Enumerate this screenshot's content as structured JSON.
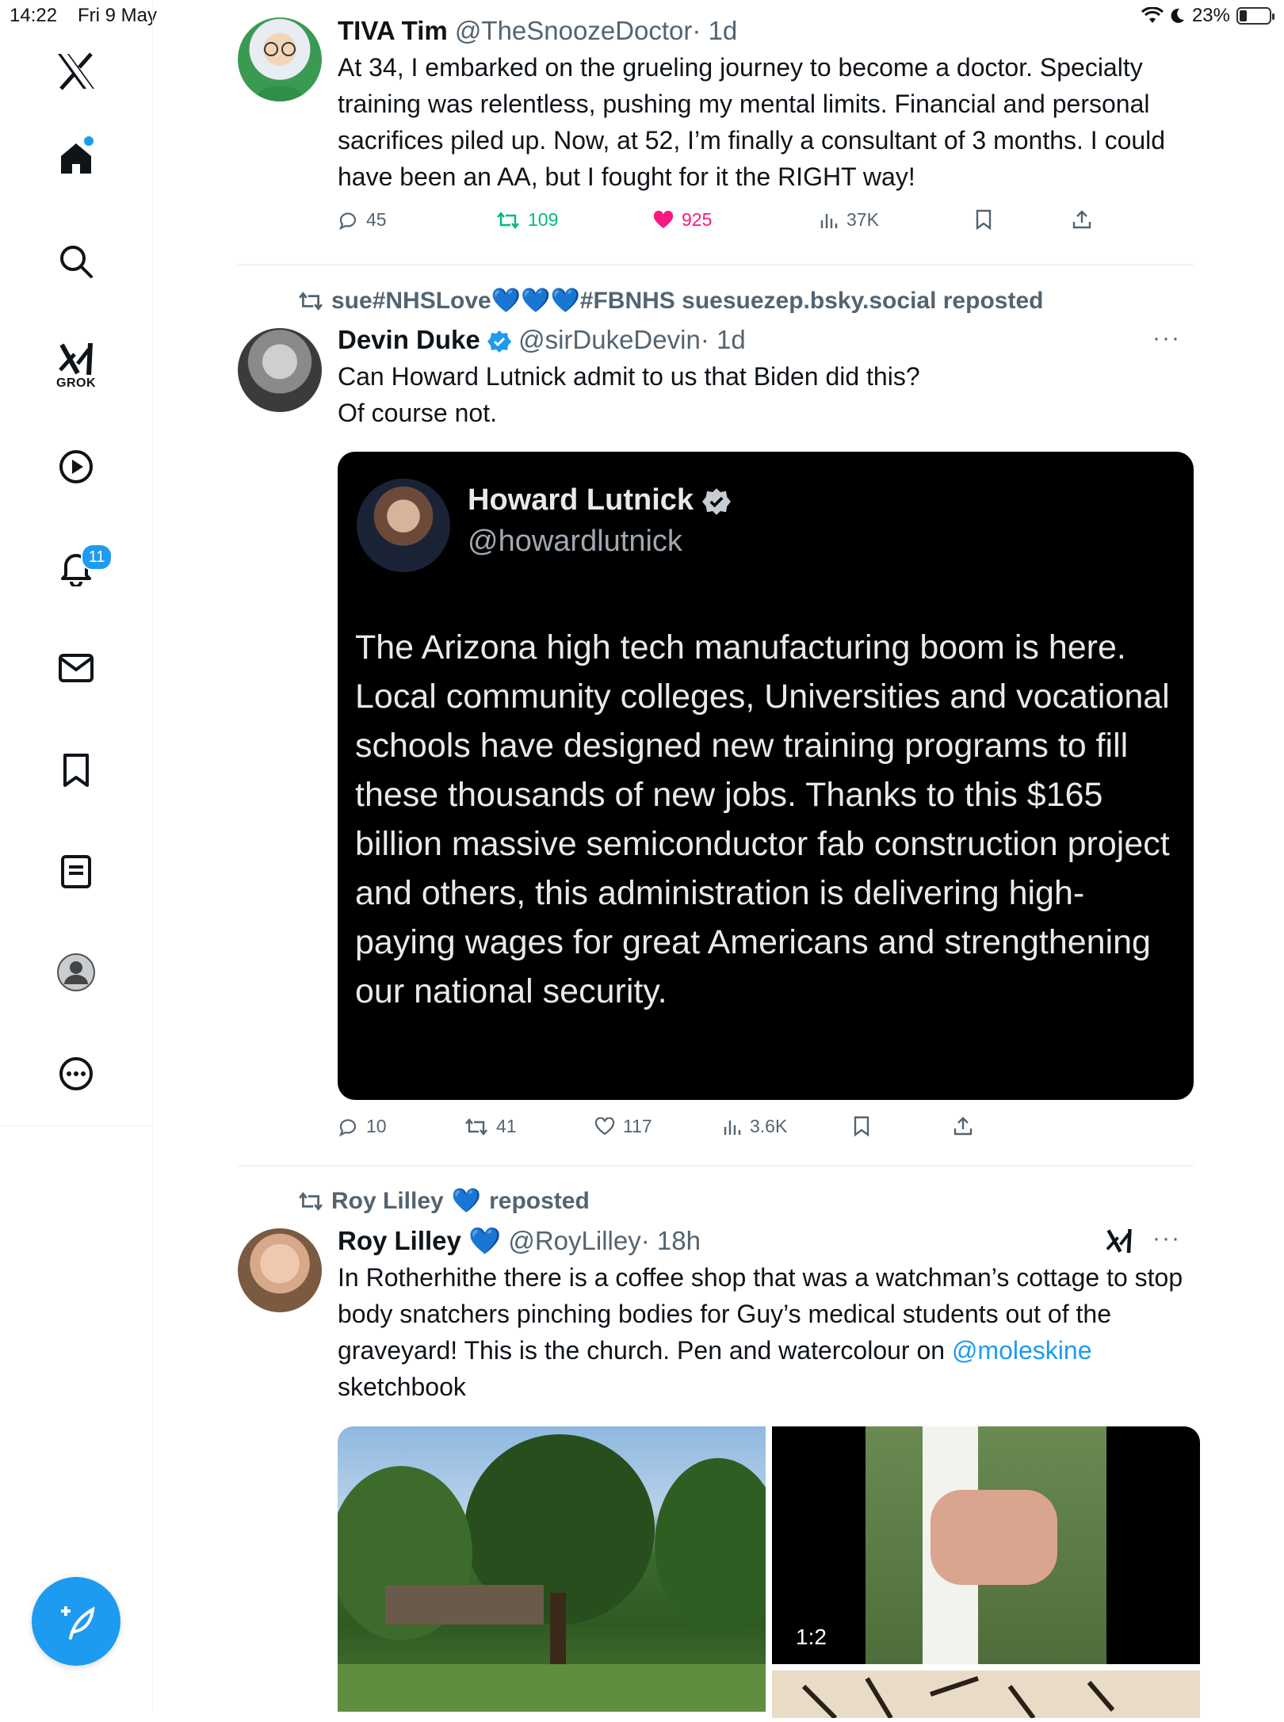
{
  "status_bar": {
    "time": "14:22",
    "date": "Fri 9 May",
    "battery": "23%"
  },
  "sidebar": {
    "grok_label": "GROK",
    "notification_count": "11"
  },
  "posts": [
    {
      "name": "TIVA Tim",
      "handle": "@TheSnoozeDoctor",
      "time": "· 1d",
      "text": "At 34, I embarked on the grueling journey to become a doctor. Specialty training was relentless, pushing my mental limits. Financial and personal sacrifices piled up. Now, at 52, I’m finally a consultant of 3 months. I could have been an AA, but I fought for it the RIGHT way!",
      "replies": "45",
      "reposts": "109",
      "likes": "925",
      "views": "37K"
    },
    {
      "reposted_by": "sue#NHSLove💙💙💙#FBNHS suesuezep.bsky.social reposted",
      "name": "Devin Duke",
      "handle": "@sirDukeDevin",
      "time": "· 1d",
      "text_line1": "Can Howard Lutnick admit to us that Biden did this?",
      "text_line2": "Of course not.",
      "quote": {
        "name": "Howard Lutnick",
        "handle": "@howardlutnick",
        "text": "The Arizona high tech manufacturing boom is here.  Local community colleges, Universities and vocational schools have designed new training programs to fill these thousands of new jobs.  Thanks to this $165 billion massive  semiconductor fab construction project and others, this administration is delivering high-paying wages for great Americans and strengthening our national security."
      },
      "replies": "10",
      "reposts": "41",
      "likes": "117",
      "views": "3.6K"
    },
    {
      "reposted_by_name": "Roy Lilley",
      "reposted_by_emoji": "💙",
      "reposted_suffix": "reposted",
      "name": "Roy Lilley",
      "name_emoji": "💙",
      "handle": "@RoyLilley",
      "time": "· 18h",
      "text": "In Rotherhithe there is a coffee shop that was a watchman’s cottage to stop body snatchers pinching bodies for Guy’s medical students out of the graveyard! This is the church. Pen and watercolour on",
      "mention": "@moleskine",
      "text_end": "sketchbook",
      "video_ratio": "1:2"
    }
  ]
}
